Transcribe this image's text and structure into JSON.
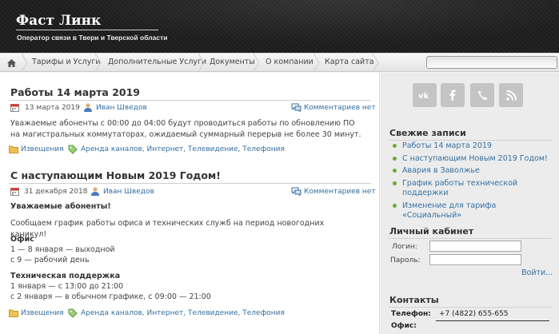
{
  "header": {
    "title": "Фаст Линк",
    "tagline": "Оператор связи в Твери и Тверской области"
  },
  "nav": {
    "items": [
      "Тарифы и Услуги",
      "Дополнительные Услуги",
      "Документы",
      "О компании",
      "Карта сайта"
    ],
    "search_placeholder": ""
  },
  "posts": [
    {
      "title": "Работы 14 марта 2019",
      "date": "13 марта 2019",
      "author": "Иван Шведов",
      "comments": "Комментариев нет",
      "body": "Уважаемые абоненты с 00:00 до 04:00 будут проводиться работы по обновлению ПО на магистральных коммутаторах, ожидаемый суммарный перерыв не более 30 минут.",
      "category": "Извещения",
      "tags": "Аренда каналов, Интернет, Телевидение, Телефония"
    },
    {
      "title": "С наступающим Новым 2019 Годом!",
      "date": "31 декабря 2018",
      "author": "Иван Шведов",
      "comments": "Комментариев нет",
      "greeting": "Уважаемые абоненты!",
      "intro": "Сообщаем график работы офиса и технических служб на период новогодних каникул!",
      "office_heading": "Офис",
      "office_line1": "1 — 8 января — выходной",
      "office_line2": "с 9 — рабочий день",
      "support_heading": "Техническая поддержка",
      "support_line1": "1 января — с 13:00 до 21:00",
      "support_line2": "с 2 января — в обычном графике, с 09:00 — 21:00",
      "category": "Извещения",
      "tags": "Аренда каналов, Интернет, Телевидение, Телефония"
    }
  ],
  "sidebar": {
    "social_icons": [
      "vk-icon",
      "facebook-icon",
      "phone-icon",
      "rss-icon"
    ],
    "recent_title": "Свежие записи",
    "recent_items": [
      "Работы 14 марта 2019",
      "С наступающим Новым 2019 Годом!",
      "Авария в Заволжье",
      "График работы технической поддержки",
      "Изменение для тарифа «Социальный»"
    ],
    "cabinet_title": "Личный кабинет",
    "login_label": "Логин:",
    "password_label": "Пароль:",
    "login_link": "Войти...",
    "contacts_title": "Контакты",
    "phone_label": "Телефон:",
    "phone_value": "+7 (4822) 655-655",
    "office_label": "Офис:"
  },
  "colors": {
    "link": "#3570a0",
    "bullet": "#6aab3a",
    "header_bg": "#1f1f1f"
  }
}
